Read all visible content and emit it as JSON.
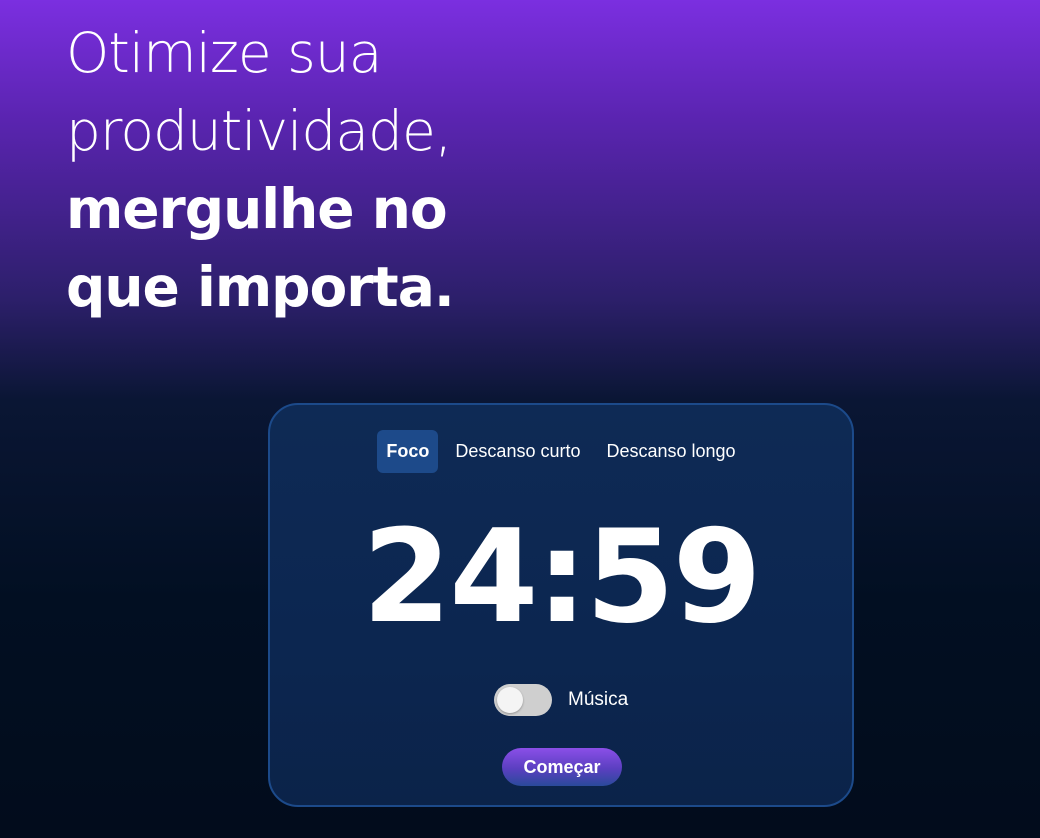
{
  "headline": {
    "line1": "Otimize sua",
    "line2": "produtividade,",
    "line3": "mergulhe no",
    "line4": "que importa."
  },
  "tabs": [
    {
      "label": "Foco",
      "active": true
    },
    {
      "label": "Descanso curto",
      "active": false
    },
    {
      "label": "Descanso longo",
      "active": false
    }
  ],
  "timer": {
    "display": "24:59"
  },
  "music": {
    "label": "Música",
    "enabled": false
  },
  "start_button": {
    "label": "Começar"
  },
  "colors": {
    "background_top": "#7b2fe0",
    "background_bottom": "#020c1c",
    "card_background": "#0e2a55",
    "card_border": "#1c4a8a",
    "active_tab": "#1d4a8a",
    "button_gradient_start": "#8b4fe8",
    "button_gradient_end": "#2a4a9a"
  }
}
